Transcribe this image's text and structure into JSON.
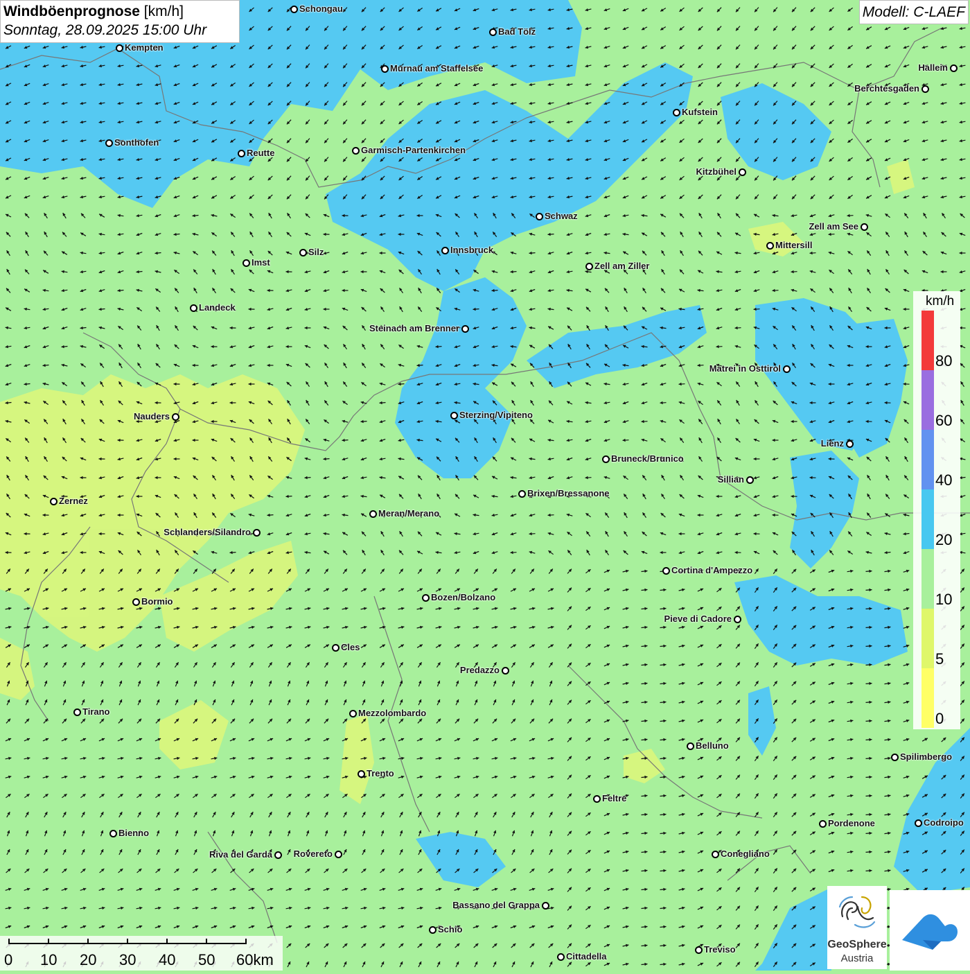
{
  "title": {
    "bold": "Windböenprognose",
    "unit": " [km/h]",
    "datetime": "Sonntag, 28.09.2025 15:00 Uhr"
  },
  "model": "Modell: C-LAEF",
  "legend": {
    "unit": "km/h",
    "labels": [
      "80",
      "60",
      "40",
      "20",
      "10",
      "5",
      "0"
    ],
    "colors": [
      "#f33a3a",
      "#9a6ee0",
      "#6292f0",
      "#48c8f0",
      "#a8f09c",
      "#dff76a",
      "#ffff66"
    ]
  },
  "scale": {
    "labels": [
      "0",
      "10",
      "20",
      "30",
      "40",
      "50",
      "60km"
    ]
  },
  "logos": {
    "geosphere_line1": "GeoSphere",
    "geosphere_line2": "Austria"
  },
  "places": [
    {
      "name": "Schongau",
      "label": "Schongau"
    },
    {
      "name": "Bad Tölz",
      "label": "Bad Tölz"
    },
    {
      "name": "Kempten",
      "label": "Kempten"
    },
    {
      "name": "Murnau",
      "label": "Murnau am Staffelsee"
    },
    {
      "name": "Hallein",
      "label": "Hallein"
    },
    {
      "name": "Berchtesgaden",
      "label": "Berchtesgaden"
    },
    {
      "name": "Kufstein",
      "label": "Kufstein"
    },
    {
      "name": "Sonthofen",
      "label": "Sonthofen"
    },
    {
      "name": "Reutte",
      "label": "Reutte"
    },
    {
      "name": "Garmisch",
      "label": "Garmisch-Partenkirchen"
    },
    {
      "name": "Kitzbühel",
      "label": "Kitzbühel"
    },
    {
      "name": "Schwaz",
      "label": "Schwaz"
    },
    {
      "name": "Zell am See",
      "label": "Zell am See"
    },
    {
      "name": "Mittersill",
      "label": "Mittersill"
    },
    {
      "name": "Innsbruck",
      "label": "Innsbruck"
    },
    {
      "name": "Silz",
      "label": "Silz"
    },
    {
      "name": "Imst",
      "label": "Imst"
    },
    {
      "name": "Zell am Ziller",
      "label": "Zell am Ziller"
    },
    {
      "name": "Landeck",
      "label": "Landeck"
    },
    {
      "name": "Steinach",
      "label": "Steinach am Brenner"
    },
    {
      "name": "Matrei",
      "label": "Matrei in Osttirol"
    },
    {
      "name": "Nauders",
      "label": "Nauders"
    },
    {
      "name": "Sterzing",
      "label": "Sterzing/Vipiteno"
    },
    {
      "name": "Lienz",
      "label": "Lienz"
    },
    {
      "name": "Bruneck",
      "label": "Bruneck/Brunico"
    },
    {
      "name": "Sillian",
      "label": "Sillian"
    },
    {
      "name": "Brixen",
      "label": "Brixen/Bressanone"
    },
    {
      "name": "Zernez",
      "label": "Zernez"
    },
    {
      "name": "Meran",
      "label": "Meran/Merano"
    },
    {
      "name": "Schlanders",
      "label": "Schlanders/Silandro"
    },
    {
      "name": "Cortina",
      "label": "Cortina d'Ampezzo"
    },
    {
      "name": "Bozen",
      "label": "Bozen/Bolzano"
    },
    {
      "name": "Bormio",
      "label": "Bormio"
    },
    {
      "name": "Pieve",
      "label": "Pieve di Cadore"
    },
    {
      "name": "Cles",
      "label": "Cles"
    },
    {
      "name": "Predazzo",
      "label": "Predazzo"
    },
    {
      "name": "Tirano",
      "label": "Tirano"
    },
    {
      "name": "Mezzolombardo",
      "label": "Mezzolombardo"
    },
    {
      "name": "Belluno",
      "label": "Belluno"
    },
    {
      "name": "Spilimbergo",
      "label": "Spilimbergo"
    },
    {
      "name": "Trento",
      "label": "Trento"
    },
    {
      "name": "Feltre",
      "label": "Feltre"
    },
    {
      "name": "Pordenone",
      "label": "Pordenone"
    },
    {
      "name": "Codroipo",
      "label": "Codroipo"
    },
    {
      "name": "Bienno",
      "label": "Bienno"
    },
    {
      "name": "Riva",
      "label": "Riva del Garda"
    },
    {
      "name": "Rovereto",
      "label": "Rovereto"
    },
    {
      "name": "Conegliano",
      "label": "Conegliano"
    },
    {
      "name": "Bassano",
      "label": "Bassano del Grappa"
    },
    {
      "name": "Schio",
      "label": "Schio"
    },
    {
      "name": "Treviso",
      "label": "Treviso"
    },
    {
      "name": "Cittadella",
      "label": "Cittadella"
    }
  ]
}
